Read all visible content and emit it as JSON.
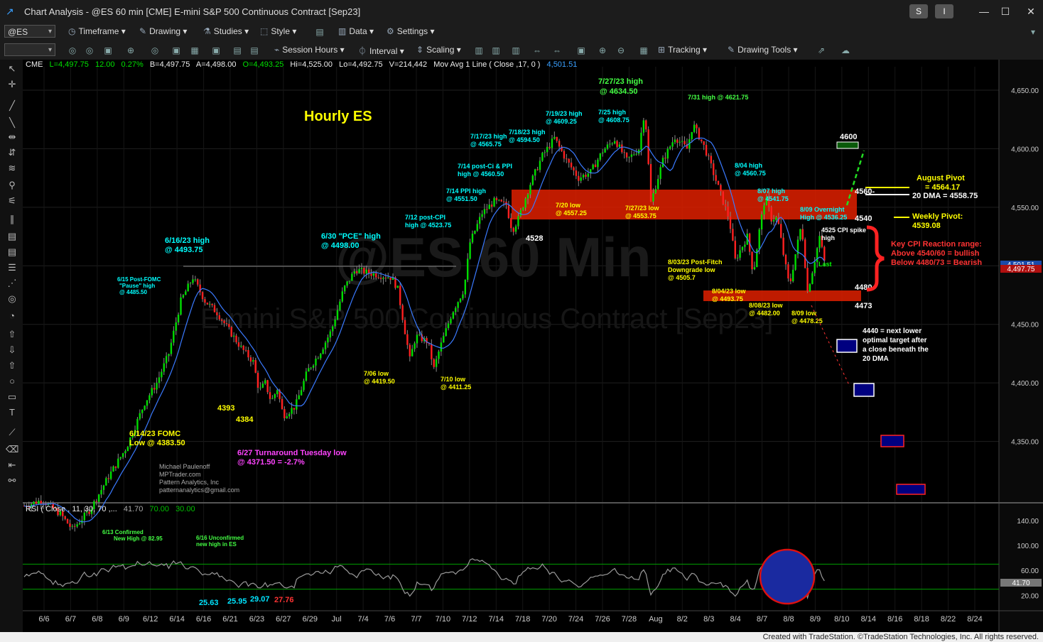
{
  "window": {
    "title": "Chart Analysis - @ES 60 min [CME] E-mini S&P 500 Continuous Contract [Sep23]",
    "btn_s": "S",
    "btn_i": "I"
  },
  "toolbar1": {
    "symbol": "@ES",
    "timeframe": "Timeframe",
    "drawing": "Drawing",
    "studies": "Studies",
    "style": "Style",
    "data": "Data",
    "settings": "Settings"
  },
  "toolbar2": {
    "session_hours": "Session Hours",
    "interval": "Interval",
    "scaling": "Scaling",
    "tracking": "Tracking",
    "drawing_tools": "Drawing Tools"
  },
  "status_line": {
    "exchange": "CME",
    "last": "L=4,497.75",
    "change": "12.00",
    "pct": "0.27%",
    "bid": "B=4,497.75",
    "ask": "A=4,498.00",
    "open": "O=4,493.25",
    "high": "Hi=4,525.00",
    "low": "Lo=4,492.75",
    "volume": "V=214,442",
    "study": "Mov Avg 1 Line ( Close ,17, 0 )",
    "study_value": "4,501.51"
  },
  "chart_data": {
    "type": "candlestick",
    "title": "Hourly ES",
    "watermark_symbol": "@ES 60 Min",
    "watermark_desc": "E-mini S&P 500 Continuous Contract [Sep23]",
    "ylim": [
      4300,
      4670
    ],
    "y_ticks": [
      "4,650.00",
      "4,600.00",
      "4,550.00",
      "4,500.00",
      "4,450.00",
      "4,400.00",
      "4,350.00"
    ],
    "y_tick_values": [
      4650,
      4600,
      4550,
      4500,
      4450,
      4400,
      4350
    ],
    "x_ticks": [
      "6/6",
      "6/7",
      "6/8",
      "6/9",
      "6/12",
      "6/14",
      "6/16",
      "6/21",
      "6/23",
      "6/27",
      "6/29",
      "Jul",
      "7/4",
      "7/6",
      "7/7",
      "7/10",
      "7/12",
      "7/14",
      "7/18",
      "7/20",
      "7/24",
      "7/26",
      "7/28",
      "Aug",
      "8/2",
      "8/3",
      "8/4",
      "8/7",
      "8/8",
      "8/9",
      "8/10",
      "8/14",
      "8/16",
      "8/18",
      "8/22",
      "8/24"
    ],
    "price_path": [
      [
        0,
        4295
      ],
      [
        3,
        4300
      ],
      [
        6,
        4288
      ],
      [
        8,
        4275
      ],
      [
        11,
        4292
      ],
      [
        14,
        4320
      ],
      [
        17,
        4345
      ],
      [
        20,
        4383
      ],
      [
        22,
        4400
      ],
      [
        24,
        4425
      ],
      [
        26,
        4470
      ],
      [
        28,
        4490
      ],
      [
        30,
        4470
      ],
      [
        32,
        4460
      ],
      [
        34,
        4445
      ],
      [
        36,
        4430
      ],
      [
        38,
        4418
      ],
      [
        39,
        4393
      ],
      [
        40,
        4400
      ],
      [
        41,
        4384
      ],
      [
        42,
        4395
      ],
      [
        43,
        4372
      ],
      [
        45,
        4380
      ],
      [
        47,
        4410
      ],
      [
        49,
        4425
      ],
      [
        51,
        4445
      ],
      [
        53,
        4480
      ],
      [
        55,
        4497
      ],
      [
        57,
        4494
      ],
      [
        59,
        4492
      ],
      [
        61,
        4490
      ],
      [
        62,
        4480
      ],
      [
        63,
        4450
      ],
      [
        64,
        4420
      ],
      [
        65,
        4440
      ],
      [
        67,
        4435
      ],
      [
        68,
        4412
      ],
      [
        69,
        4430
      ],
      [
        71,
        4460
      ],
      [
        73,
        4480
      ],
      [
        74,
        4520
      ],
      [
        76,
        4545
      ],
      [
        78,
        4555
      ],
      [
        80,
        4552
      ],
      [
        81,
        4530
      ],
      [
        82,
        4540
      ],
      [
        84,
        4570
      ],
      [
        86,
        4594
      ],
      [
        88,
        4609
      ],
      [
        90,
        4590
      ],
      [
        92,
        4575
      ],
      [
        94,
        4580
      ],
      [
        96,
        4598
      ],
      [
        98,
        4608
      ],
      [
        100,
        4590
      ],
      [
        102,
        4600
      ],
      [
        103,
        4634
      ],
      [
        104,
        4554
      ],
      [
        106,
        4590
      ],
      [
        108,
        4610
      ],
      [
        110,
        4600
      ],
      [
        111,
        4621
      ],
      [
        113,
        4600
      ],
      [
        115,
        4570
      ],
      [
        117,
        4540
      ],
      [
        118,
        4505
      ],
      [
        119,
        4515
      ],
      [
        120,
        4525
      ],
      [
        121,
        4493
      ],
      [
        122,
        4530
      ],
      [
        123,
        4560
      ],
      [
        124,
        4540
      ],
      [
        125,
        4541
      ],
      [
        126,
        4510
      ],
      [
        127,
        4482
      ],
      [
        128,
        4510
      ],
      [
        129,
        4536
      ],
      [
        130,
        4478
      ],
      [
        131,
        4500
      ],
      [
        132,
        4525
      ],
      [
        133,
        4498
      ]
    ],
    "x_slots": 133,
    "moving_average": {
      "name": "Mov Avg 1 Line",
      "length": 17,
      "last": 4501.51
    },
    "horizontal_levels": [
      {
        "label": "4600",
        "value": 4600
      },
      {
        "label": "4560-",
        "value": 4560
      },
      {
        "label": "4540",
        "value": 4540
      },
      {
        "label": "4480-",
        "value": 4480
      },
      {
        "label": "4473",
        "value": 4473
      }
    ],
    "annotations": [
      {
        "text": "Hourly ES",
        "color": "#ffff00"
      },
      {
        "text": "6/16/23 high",
        "sub": "@ 4493.75",
        "color": "#00ffff"
      },
      {
        "text": "6/15 Post-FOMC",
        "sub": "\"Pause\" high",
        "sub2": "@ 4485.50",
        "color": "#00ffff"
      },
      {
        "text": "6/14/23 FOMC",
        "sub": "Low @ 4383.50",
        "color": "#ffff00"
      },
      {
        "text": "4393",
        "color": "#ffff00"
      },
      {
        "text": "4384",
        "color": "#ffff00"
      },
      {
        "text": "6/27 Turnaround Tuesday low",
        "sub": "@ 4371.50 = -2.7%",
        "color": "#ff44ff"
      },
      {
        "text": "6/30 \"PCE\" high",
        "sub": "@ 4498.00",
        "color": "#00ffff"
      },
      {
        "text": "7/06 low",
        "sub": "@ 4419.50",
        "color": "#ffff00"
      },
      {
        "text": "7/10 low",
        "sub": "@ 4411.25",
        "color": "#ffff00"
      },
      {
        "text": "7/12 post-CPI",
        "sub": "high @ 4523.75",
        "color": "#00ffff"
      },
      {
        "text": "7/14 PPI high",
        "sub": "@ 4551.50",
        "color": "#00ffff"
      },
      {
        "text": "7/14 post-Ci & PPI",
        "sub": "high @ 4560.50",
        "color": "#00ffff"
      },
      {
        "text": "7/17/23 high",
        "sub": "@ 4565.75",
        "color": "#00ffff"
      },
      {
        "text": "7/18/23 high",
        "sub": "@ 4594.50",
        "color": "#00ffff"
      },
      {
        "text": "4528",
        "color": "#ffffff"
      },
      {
        "text": "7/19/23 high",
        "sub": "@ 4609.25",
        "color": "#00ffff"
      },
      {
        "text": "7/25 high",
        "sub": "@ 4608.75",
        "color": "#00ffff"
      },
      {
        "text": "7/27/23 high",
        "sub": "@ 4634.50",
        "color": "#44ff44"
      },
      {
        "text": "7/31 high @ 4621.75",
        "color": "#44ff44"
      },
      {
        "text": "7/20 low",
        "sub": "@ 4557.25",
        "color": "#ffff00"
      },
      {
        "text": "7/27/23 low",
        "sub": "@ 4553.75",
        "color": "#ffff00"
      },
      {
        "text": "8/04 high",
        "sub": "@ 4560.75",
        "color": "#00ffff"
      },
      {
        "text": "8/07 high",
        "sub": "@ 4541.75",
        "color": "#00ffff"
      },
      {
        "text": "8/09 Overnight",
        "sub": "High @ 4536.25",
        "color": "#00ffff"
      },
      {
        "text": "4525 CPI spike",
        "sub": "high",
        "color": "#ffffff"
      },
      {
        "text": "8/03/23 Post-Fitch",
        "sub": "Downgrade low",
        "sub2": "@ 4505.7",
        "color": "#ffff00"
      },
      {
        "text": "8/04/23 low",
        "sub": "@ 4493.75",
        "color": "#ffff00"
      },
      {
        "text": "8/08/23 low",
        "sub": "@ 4482.00",
        "color": "#ffff00"
      },
      {
        "text": "8/09 low",
        "sub": "@ 4478.25",
        "color": "#ffff00"
      },
      {
        "text": "Last",
        "color": "#00ff00"
      },
      {
        "text": "August Pivot",
        "sub": "= 4564.17",
        "color": "#ffff00"
      },
      {
        "text": "20 DMA = 4558.75",
        "color": "#ffffff"
      },
      {
        "text": "Weekly Pivot:",
        "sub": "4539.08",
        "color": "#ffff00"
      },
      {
        "text": "Key CPI Reaction range:",
        "sub": "Above 4540/60 = bullish",
        "sub2": "Below 4480/73 = Bearish",
        "color": "#ff3333"
      },
      {
        "text": "4440 = next lower",
        "sub": "optimal target after",
        "sub2": "a close beneath the",
        "sub3": "20 DMA",
        "color": "#ffffff"
      }
    ],
    "credits": [
      "Michael Paulenoff",
      "MPTrader.com",
      "Pattern Analytics, Inc",
      "patternanalytics@gmail.com"
    ],
    "price_tags": [
      "4,501.51",
      "4,497.75"
    ]
  },
  "rsi_panel": {
    "header": "RSI ( Close , 11, 30, 70 ,...",
    "value": "41.70",
    "overbought": "70.00",
    "oversold": "30.00",
    "ylim": [
      0,
      150
    ],
    "y_ticks": [
      "140.00",
      "100.00",
      "60.00",
      "20.00"
    ],
    "y_tick_values": [
      140,
      100,
      60,
      20
    ],
    "current_tag": "41.70",
    "lows": [
      "25.63",
      "25.95",
      "29.07",
      "27.76"
    ],
    "notes": [
      {
        "text": "6/13 Confirmed",
        "sub": "New High @ 82.95"
      },
      {
        "text": "6/16 Unconfirmed",
        "sub": "new high in ES"
      }
    ]
  },
  "footer": {
    "text": "Created with TradeStation. ©TradeStation Technologies, Inc. All rights reserved."
  }
}
